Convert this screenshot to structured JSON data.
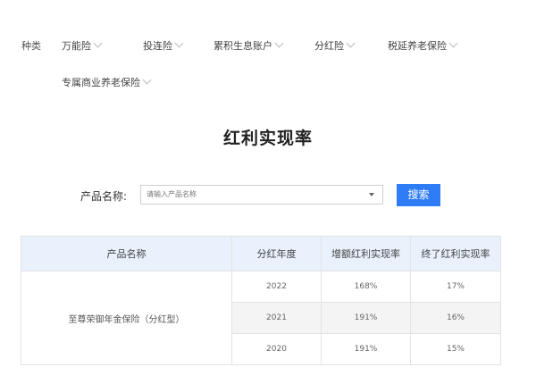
{
  "categories": {
    "label": "种类",
    "items": [
      {
        "label": "万能险"
      },
      {
        "label": "投连险"
      },
      {
        "label": "累积生息账户"
      },
      {
        "label": "分红险"
      },
      {
        "label": "税延养老保险"
      },
      {
        "label": "专属商业养老保险"
      }
    ]
  },
  "page_title": "红利实现率",
  "search": {
    "label": "产品名称:",
    "placeholder": "请输入产品名称",
    "button_label": "搜索"
  },
  "table": {
    "headers": [
      "产品名称",
      "分红年度",
      "增额红利实现率",
      "终了红利实现率"
    ],
    "product_name": "至尊荣御年金保险（分红型）",
    "rows": [
      {
        "year": "2022",
        "increase_rate": "168%",
        "terminal_rate": "17%"
      },
      {
        "year": "2021",
        "increase_rate": "191%",
        "terminal_rate": "16%"
      },
      {
        "year": "2020",
        "increase_rate": "191%",
        "terminal_rate": "15%"
      }
    ]
  },
  "colors": {
    "accent": "#2f7df6",
    "header_bg": "#e8f1fc"
  }
}
